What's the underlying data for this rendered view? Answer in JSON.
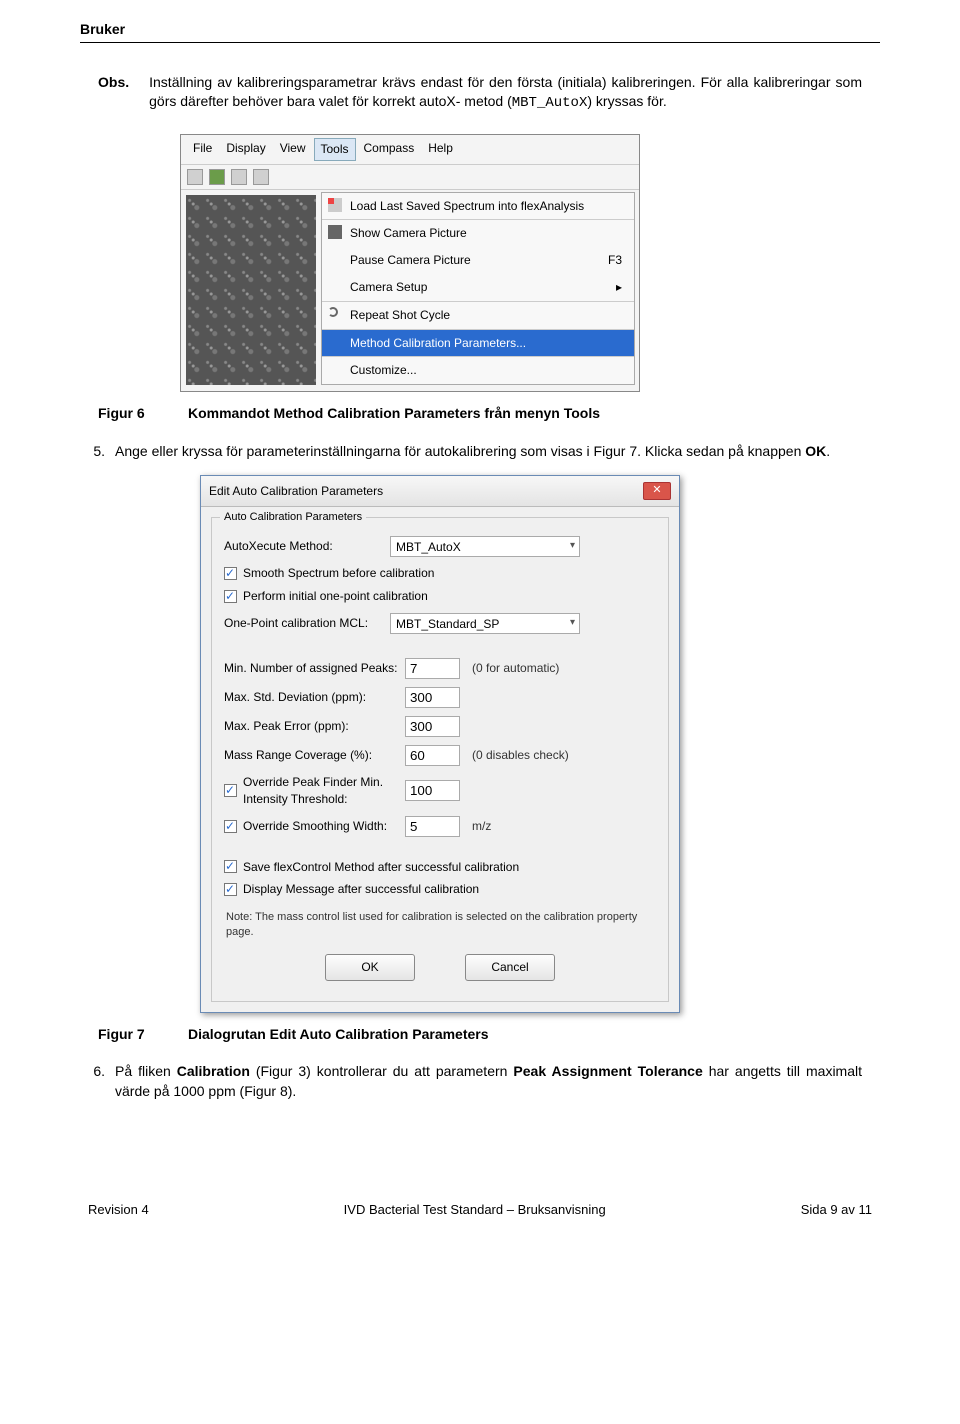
{
  "header": {
    "brand": "Bruker"
  },
  "obs": {
    "label": "Obs.",
    "text_before": "Inställning av kalibreringsparametrar krävs endast för den första (initiala) kalibreringen. För alla kalibreringar som görs därefter behöver bara valet för korrekt autoX- metod (",
    "code": "MBT_AutoX",
    "text_after": ") kryssas för."
  },
  "ss1": {
    "menubar": [
      "File",
      "Display",
      "View",
      "Tools",
      "Compass",
      "Help"
    ],
    "open_index": 3,
    "menu_items": [
      {
        "label": "Load Last Saved Spectrum into flexAnalysis",
        "shortcut": "",
        "icon": "load",
        "sep": false,
        "sel": false
      },
      {
        "label": "Show Camera Picture",
        "shortcut": "",
        "icon": "cam",
        "sep": true,
        "sel": false
      },
      {
        "label": "Pause Camera Picture",
        "shortcut": "F3",
        "icon": "",
        "sep": false,
        "sel": false
      },
      {
        "label": "Camera Setup",
        "shortcut": "▸",
        "icon": "",
        "sep": false,
        "sel": false
      },
      {
        "label": "Repeat Shot Cycle",
        "shortcut": "",
        "icon": "cyc",
        "sep": true,
        "sel": false
      },
      {
        "label": "Method Calibration Parameters...",
        "shortcut": "",
        "icon": "",
        "sep": true,
        "sel": true
      },
      {
        "label": "Customize...",
        "shortcut": "",
        "icon": "",
        "sep": true,
        "sel": false
      }
    ]
  },
  "fig6": {
    "label": "Figur 6",
    "caption": "Kommandot Method Calibration Parameters från menyn Tools"
  },
  "step5": {
    "num": "5.",
    "text": "Ange eller kryssa för parameterinställningarna för autokalibrering som visas i Figur 7. Klicka sedan på knappen ",
    "bold": "OK",
    "after": "."
  },
  "ss2": {
    "title": "Edit Auto Calibration Parameters",
    "group": "Auto Calibration Parameters",
    "autoxecute_label": "AutoXecute Method:",
    "autoxecute_value": "MBT_AutoX",
    "chk_smooth": "Smooth Spectrum before calibration",
    "chk_initial": "Perform initial one-point calibration",
    "onepoint_label": "One-Point calibration MCL:",
    "onepoint_value": "MBT_Standard_SP",
    "min_peaks_label": "Min. Number of assigned Peaks:",
    "min_peaks_value": "7",
    "min_peaks_hint": "(0 for automatic)",
    "max_std_label": "Max. Std. Deviation (ppm):",
    "max_std_value": "300",
    "max_err_label": "Max. Peak Error (ppm):",
    "max_err_value": "300",
    "mass_cov_label": "Mass Range Coverage (%):",
    "mass_cov_value": "60",
    "mass_cov_hint": "(0 disables check)",
    "chk_override_int": "Override Peak Finder Min. Intensity Threshold:",
    "override_int_value": "100",
    "chk_override_sm": "Override Smoothing Width:",
    "override_sm_value": "5",
    "override_sm_unit": "m/z",
    "chk_save": "Save flexControl Method after successful calibration",
    "chk_display": "Display Message after successful calibration",
    "note": "Note: The mass control list used for calibration is selected on the calibration property page.",
    "ok": "OK",
    "cancel": "Cancel"
  },
  "fig7": {
    "label": "Figur 7",
    "caption": "Dialogrutan Edit Auto Calibration Parameters"
  },
  "step6": {
    "num": "6.",
    "t1": "På fliken ",
    "b1": "Calibration",
    "t2": " (Figur 3) kontrollerar du att parametern ",
    "b2": "Peak Assignment Tolerance",
    "t3": " har angetts till maximalt värde på 1000 ppm (Figur 8)."
  },
  "footer": {
    "left": "Revision 4",
    "center": "IVD Bacterial Test Standard – Bruksanvisning",
    "right": "Sida 9 av 11"
  }
}
